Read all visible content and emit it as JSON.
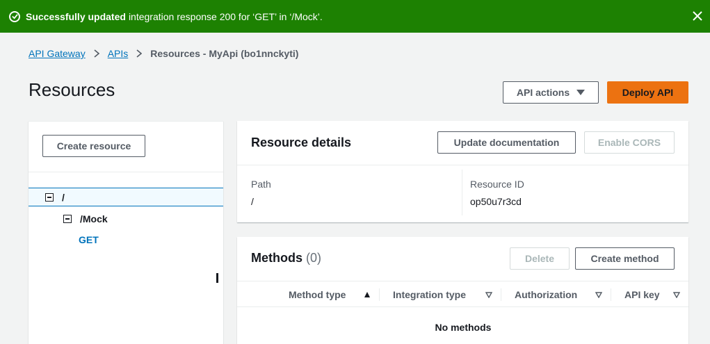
{
  "flash": {
    "bold": "Successfully updated",
    "text": "integration response 200 for ‘GET’ in ‘/Mock’.",
    "color": "#1d8102",
    "icon": "check-circle-icon",
    "close_icon": "close-icon"
  },
  "breadcrumb": {
    "items": [
      "API Gateway",
      "APIs"
    ],
    "current": "Resources - MyApi (bo1nnckyti)"
  },
  "page": {
    "title": "Resources",
    "api_actions": "API actions",
    "deploy": "Deploy API",
    "accent": "#ec7211"
  },
  "tree": {
    "create_resource": "Create resource",
    "nodes": [
      {
        "label": "/",
        "selected": true
      },
      {
        "label": "/Mock"
      },
      {
        "label": "GET"
      }
    ]
  },
  "resource_details": {
    "title": "Resource details",
    "update_doc": "Update documentation",
    "enable_cors": "Enable CORS",
    "path_label": "Path",
    "path_value": "/",
    "id_label": "Resource ID",
    "id_value": "op50u7r3cd"
  },
  "methods": {
    "title": "Methods",
    "count": "(0)",
    "delete": "Delete",
    "create": "Create method",
    "columns": [
      "Method type",
      "Integration type",
      "Authorization",
      "API key"
    ],
    "empty": "No methods"
  }
}
